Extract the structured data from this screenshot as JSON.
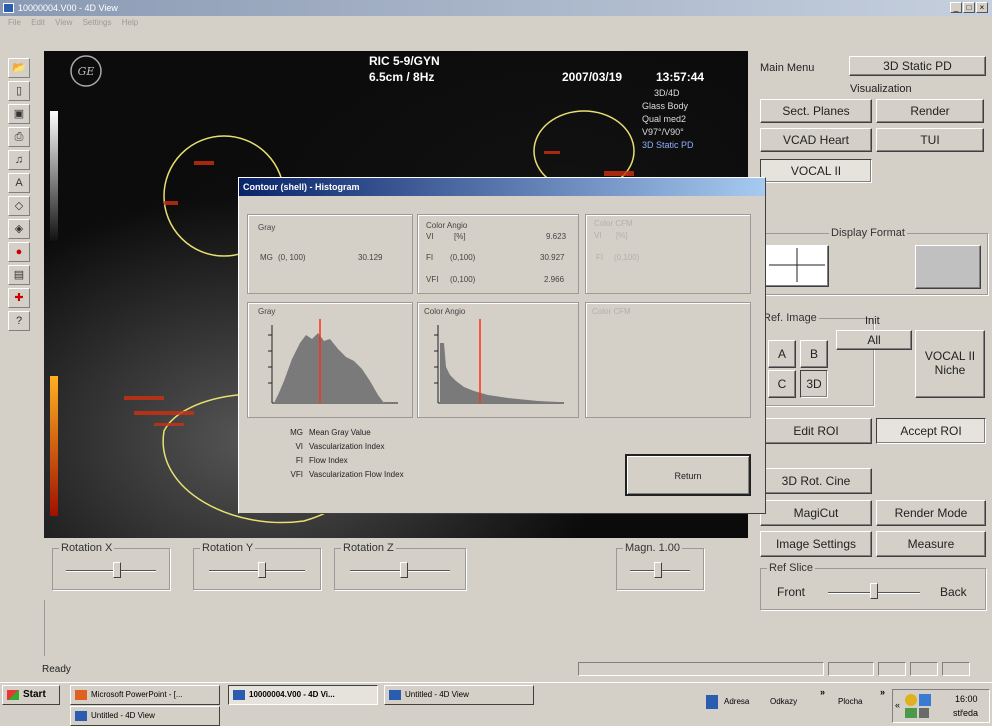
{
  "window": {
    "title": "10000004.V00 - 4D View"
  },
  "menu": [
    "File",
    "Edit",
    "View",
    "Settings",
    "Help"
  ],
  "toolbar_icons": [
    "open-icon",
    "new-icon",
    "save-icon",
    "print-icon",
    "sound-icon",
    "text-a-icon",
    "diamond-icon",
    "diamond-alt-icon",
    "record-icon",
    "image-icon",
    "measure-icon",
    "help-icon"
  ],
  "overlay": {
    "logo": "GE",
    "probe": "RIC 5-9/GYN",
    "depth": "6.5cm / 8Hz",
    "date": "2007/03/19",
    "time": "13:57:44",
    "mode1": "3D/4D",
    "mode2": "Glass Body",
    "mode3": "Qual med2",
    "mode4": "V97°/V90°",
    "mode5": "3D Static PD"
  },
  "right_panel": {
    "main_menu": "Main Menu",
    "mode_tab": "3D Static PD",
    "visualization": "Visualization",
    "sect_planes": "Sect. Planes",
    "render": "Render",
    "vcad_heart": "VCAD Heart",
    "tui": "TUI",
    "vocal": "VOCAL II",
    "display_format": "Display Format",
    "ref_image": "Ref. Image",
    "init": "Init",
    "a": "A",
    "b": "B",
    "c": "C",
    "d3": "3D",
    "all": "All",
    "vocal_niche": "VOCAL II Niche",
    "edit_roi": "Edit ROI",
    "accept_roi": "Accept ROI",
    "rot_cine": "3D Rot. Cine",
    "magicut": "MagiCut",
    "render_mode": "Render Mode",
    "image_settings": "Image Settings",
    "measure": "Measure",
    "ref_slice": "Ref Slice",
    "front": "Front",
    "back": "Back"
  },
  "rotation": {
    "x": "Rotation X",
    "y": "Rotation Y",
    "z": "Rotation Z",
    "magn": "Magn. 1.00"
  },
  "dialog": {
    "title": "Contour (shell) - Histogram",
    "gray": {
      "label": "Gray",
      "mg_label": "MG",
      "mg_range": "(0, 100)",
      "mg_value": "30.129"
    },
    "angio": {
      "label": "Color Angio",
      "vi": "VI",
      "vi_unit": "[%]",
      "vi_value": "9.623",
      "fi": "FI",
      "fi_range": "(0,100)",
      "fi_value": "30.927",
      "vfi": "VFI",
      "vfi_range": "(0,100)",
      "vfi_value": "2.966"
    },
    "cfm": {
      "label": "Color CFM",
      "vi": "VI",
      "vi_unit": "[%]",
      "fi": "FI",
      "fi_range": "(0,100)"
    },
    "hist_gray": "Gray",
    "hist_angio": "Color Angio",
    "hist_cfm": "Color CFM",
    "legend": [
      {
        "k": "MG",
        "v": "Mean Gray Value"
      },
      {
        "k": "VI",
        "v": "Vascularization Index"
      },
      {
        "k": "FI",
        "v": "Flow Index"
      },
      {
        "k": "VFI",
        "v": "Vascularization Flow Index"
      }
    ],
    "return": "Return"
  },
  "status": "Ready",
  "taskbar": {
    "start": "Start",
    "items": [
      "Microsoft PowerPoint - [...",
      "10000004.V00 - 4D Vi...",
      "Untitled - 4D View",
      "Untitled - 4D View"
    ],
    "address": "Adresa",
    "links": "Odkazy",
    "desktop": "Plocha",
    "time": "16:00",
    "day": "středa"
  }
}
